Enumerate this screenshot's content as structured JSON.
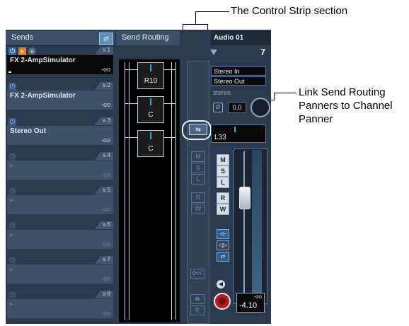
{
  "callouts": {
    "control_strip": "The Control Strip section",
    "link_send_line1": "Link Send Routing",
    "link_send_line2": "Panners to Channel",
    "link_send_line3": "Panner"
  },
  "sends": {
    "title": "Sends",
    "slots": [
      {
        "num": "s 1",
        "name": "FX 2-AmpSimulator",
        "value": "-oo",
        "active": true
      },
      {
        "num": "s 2",
        "name": "FX 2-AmpSimulator",
        "value": "-oo",
        "active": false
      },
      {
        "num": "s 3",
        "name": "Stereo Out",
        "value": "-oo",
        "active": false
      },
      {
        "num": "s 4",
        "name": "",
        "value": "-oo",
        "active": false
      },
      {
        "num": "s 5",
        "name": "",
        "value": "-oo",
        "active": false
      },
      {
        "num": "s 6",
        "name": "",
        "value": "-oo",
        "active": false
      },
      {
        "num": "s 7",
        "name": "",
        "value": "-oo",
        "active": false
      },
      {
        "num": "s 8",
        "name": "",
        "value": "-oo",
        "active": false
      }
    ]
  },
  "routing": {
    "title": "Send Routing",
    "panners": [
      {
        "label": "R10"
      },
      {
        "label": "C"
      },
      {
        "label": "C"
      }
    ]
  },
  "channel": {
    "name": "Audio 01",
    "number": "7",
    "input": "Stereo In",
    "output": "Stereo Out",
    "config": "stereo",
    "phase_label": "Ø",
    "gain": "0.0",
    "pan": "L33",
    "volume_top": "-oo",
    "volume": "-4.10"
  },
  "controls": {
    "m": "M",
    "s": "S",
    "l": "L",
    "r": "R",
    "w": "W",
    "ctrl_m": "M",
    "ctrl_s": "S",
    "ctrl_l": "L",
    "ctrl_r": "R",
    "ctrl_w": "W",
    "zero": "0<<"
  },
  "colors": {
    "accent": "#2fa9e6",
    "panel": "#2b3b4f",
    "record": "#b41c1c"
  }
}
